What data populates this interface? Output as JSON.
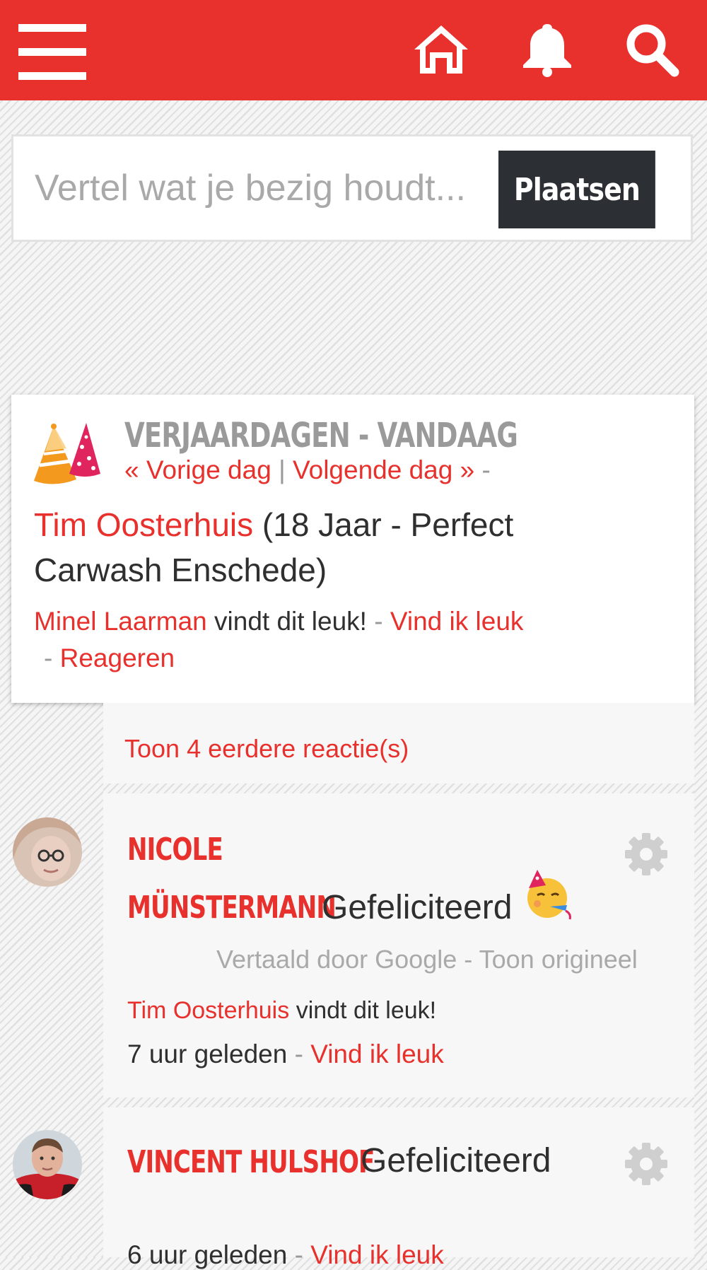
{
  "header": {
    "icons": [
      "menu-icon",
      "home-icon",
      "bell-icon",
      "search-icon"
    ],
    "accent": "#e8302c"
  },
  "composer": {
    "placeholder": "Vertel wat je bezig houdt...",
    "submit_label": "Plaatsen"
  },
  "birthdays": {
    "title": "VERJAARDAGEN - VANDAAG",
    "prev_day": "« Vorige dag",
    "separator": "|",
    "next_day": "Volgende dag »",
    "trailing": "-",
    "person_name": "Tim Oosterhuis",
    "person_details": "(18 Jaar - Perfect Carwash Enschede)",
    "liked_by": "Minel Laarman",
    "liked_text": "vindt dit leuk!",
    "dash": "-",
    "like_action": "Vind ik leuk",
    "reply_action": "Reageren"
  },
  "comments": {
    "show_more": "Toon 4 eerdere reactie(s)",
    "items": [
      {
        "author_line1": "NICOLE",
        "author_line2": "MÜNSTERMANN",
        "text": "Gefeliciteerd",
        "emoji": "partying-face-icon",
        "translated_by": "Vertaald door Google",
        "dash": "-",
        "show_original": "Toon origineel",
        "liked_by": "Tim Oosterhuis",
        "liked_text": "vindt dit leuk!",
        "time": "7 uur geleden",
        "like_action": "Vind ik leuk"
      },
      {
        "author": "VINCENT HULSHOF",
        "text": "Gefeliciteerd",
        "time": "6 uur geleden",
        "like_action": "Vind ik leuk"
      }
    ]
  }
}
